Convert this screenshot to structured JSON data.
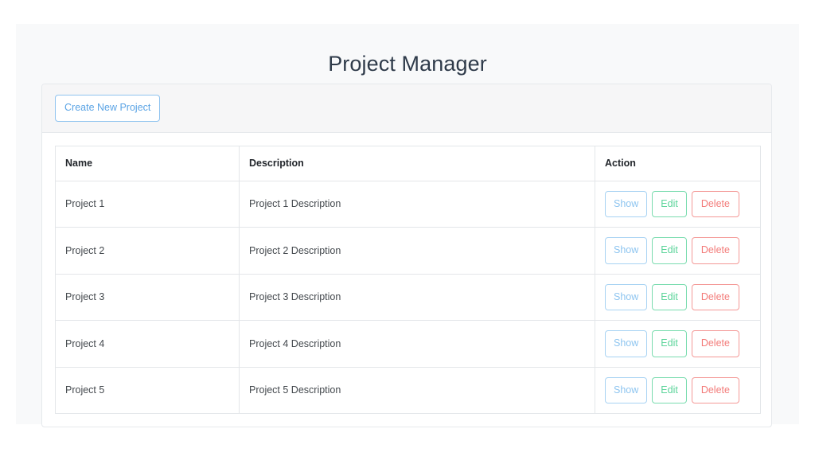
{
  "page": {
    "title": "Project Manager",
    "background_color": "#f8f9fa",
    "title_color": "#2f3b4a"
  },
  "toolbar": {
    "create_label": "Create New Project",
    "create_color": "#5ba4e5"
  },
  "table": {
    "headers": {
      "name": "Name",
      "description": "Description",
      "action": "Action"
    },
    "actions": {
      "show_label": "Show",
      "edit_label": "Edit",
      "delete_label": "Delete",
      "show_color": "#8ec5f0",
      "edit_color": "#5cd49a",
      "delete_color": "#f37c7a"
    },
    "rows": [
      {
        "name": "Project 1",
        "description": "Project 1 Description"
      },
      {
        "name": "Project 2",
        "description": "Project 2 Description"
      },
      {
        "name": "Project 3",
        "description": "Project 3 Description"
      },
      {
        "name": "Project 4",
        "description": "Project 4 Description"
      },
      {
        "name": "Project 5",
        "description": "Project 5 Description"
      }
    ]
  }
}
